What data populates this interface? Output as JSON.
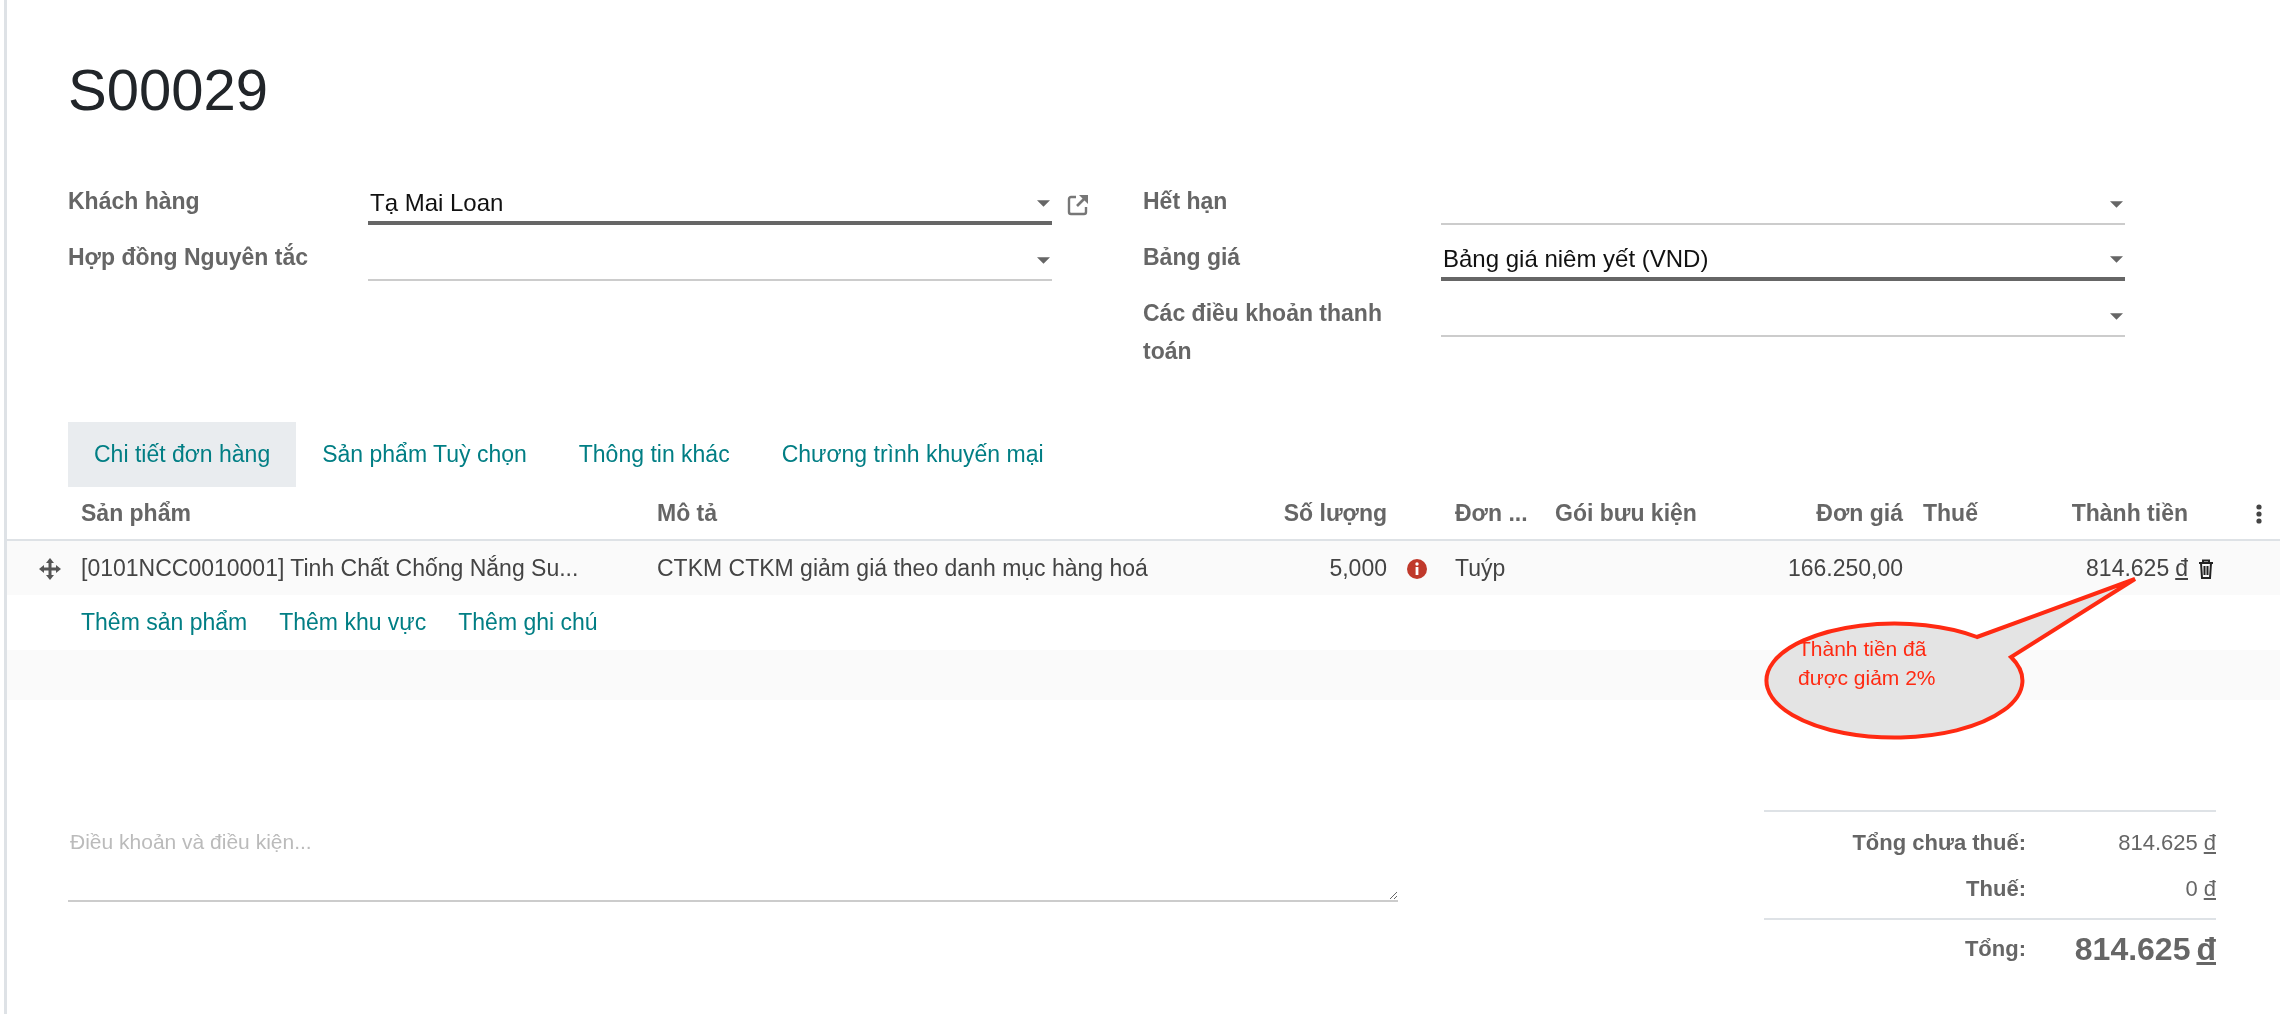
{
  "record": {
    "name": "S00029"
  },
  "fields_left": [
    {
      "label": "Khách hàng",
      "value": "Tạ Mai Loan",
      "required": true,
      "external_link": true
    },
    {
      "label": "Hợp đồng Nguyên tắc",
      "required": false,
      "external_link": false
    }
  ],
  "fields_right": [
    {
      "label": "Hết hạn",
      "required": false,
      "external_link": false
    },
    {
      "label": "Bảng giá",
      "value": "Bảng giá niêm yết (VND)",
      "required": true,
      "external_link": false
    },
    {
      "label": "Các điều khoản thanh toán",
      "required": false,
      "external_link": false
    }
  ],
  "tabs": [
    {
      "label": "Chi tiết đơn hàng",
      "selected": true
    },
    {
      "label": "Sản phẩm Tuỳ chọn",
      "selected": false
    },
    {
      "label": "Thông tin khác",
      "selected": false
    },
    {
      "label": "Chương trình khuyến mại",
      "selected": false
    }
  ],
  "table": {
    "columns": [
      {
        "label": "Sản phẩm"
      },
      {
        "label": "Mô tả"
      },
      {
        "label": "Số lượng"
      },
      {
        "label": "Đơn ..."
      },
      {
        "label": "Gói bưu kiện"
      },
      {
        "label": "Đơn giá"
      },
      {
        "label": "Thuế"
      },
      {
        "label": "Thành tiền"
      }
    ],
    "rows": [
      {
        "product": "[0101NCC0010001] Tinh Chất Chống Nắng Su...",
        "description": "CTKM CTKM giảm giá theo danh mục hàng hoá",
        "quantity": "5,000",
        "quantity_warning": true,
        "unit": "Tuýp",
        "unit_price": "166.250,00",
        "subtotal": "814.625",
        "currency": "đ"
      }
    ],
    "add_links": [
      "Thêm sản phẩm",
      "Thêm khu vực",
      "Thêm ghi chú"
    ]
  },
  "annotation": {
    "text": "Thành tiền đã được giảm 2%"
  },
  "terms": {
    "placeholder": "Điều khoản và điều kiện..."
  },
  "totals": [
    {
      "label": "Tổng chưa thuế:",
      "amount": "814.625",
      "currency": "đ",
      "kind": "line"
    },
    {
      "label": "Thuế:",
      "amount": "0",
      "currency": "đ",
      "kind": "line"
    },
    {
      "label": "Tổng:",
      "amount": "814.625",
      "currency": "đ",
      "kind": "grand"
    }
  ]
}
